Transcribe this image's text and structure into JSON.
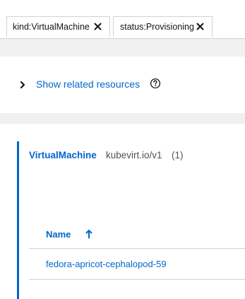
{
  "filters": {
    "chips": [
      {
        "label": "kind:VirtualMachine"
      },
      {
        "label": "status:Provisioning"
      }
    ]
  },
  "related": {
    "label": "Show related resources"
  },
  "resource_group": {
    "kind": "VirtualMachine",
    "api_version": "kubevirt.io/v1",
    "count": "(1)",
    "table": {
      "column_header": "Name",
      "sort_direction": "ascending",
      "rows": [
        {
          "name": "fedora-apricot-cephalopod-59"
        }
      ]
    }
  },
  "colors": {
    "link": "#0066cc",
    "muted_text": "#4f5255",
    "border": "#d2d2d2",
    "background": "#f0f0f0"
  }
}
